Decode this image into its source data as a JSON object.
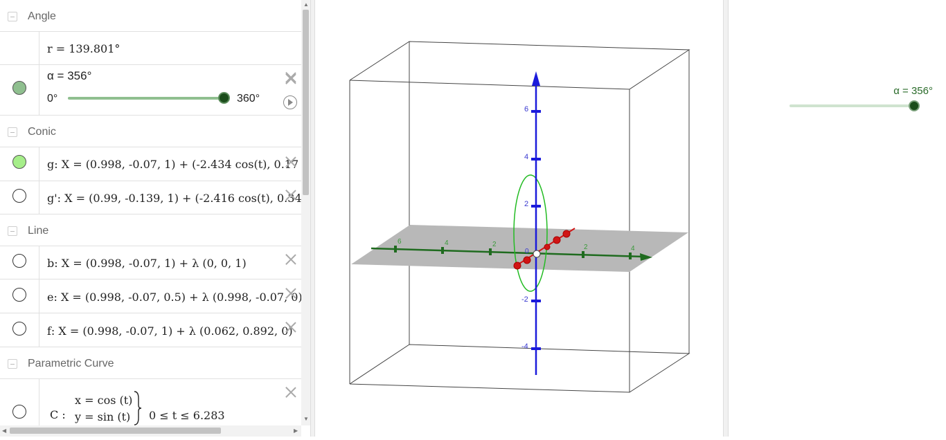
{
  "algebra": {
    "groups": {
      "angle": "Angle",
      "conic": "Conic",
      "line": "Line",
      "param": "Parametric Curve"
    },
    "rows": {
      "r": "r = 139.801°",
      "alpha": "α = 356°",
      "alpha_min": "0°",
      "alpha_max": "360°",
      "g": "g: X = (0.998, -0.07, 1) + (-2.434 cos(t), 0.17 c",
      "gprime": "g': X = (0.99, -0.139, 1) + (-2.416 cos(t), 0.34",
      "b": "b: X = (0.998, -0.07, 1) + λ (0, 0, 1)",
      "e": "e: X = (0.998, -0.07, 0.5) + λ (0.998, -0.07, 0)",
      "f": "f: X = (0.998, -0.07, 1) + λ (0.062, 0.892, 0)",
      "c_name": "C :",
      "c_x": "x = cos (t)",
      "c_y": "y = sin (t)",
      "c_range": "0 ≤ t ≤ 6.283"
    },
    "alpha_slider_fraction": 0.989
  },
  "graphics": {
    "slider_label": "α = 356°",
    "slider_fraction": 0.989
  },
  "view3d": {
    "z_ticks": [
      "6",
      "4",
      "2",
      "-2",
      "-4"
    ],
    "x_ticks": [
      "6",
      "4",
      "2",
      "2",
      "4"
    ],
    "origin": "0",
    "colors": {
      "z_axis": "#1a1adb",
      "x_axis": "#1f6b1f",
      "y_axis": "#d01515",
      "plane": "#b8b8b8",
      "ellipse": "#22bb22"
    }
  }
}
